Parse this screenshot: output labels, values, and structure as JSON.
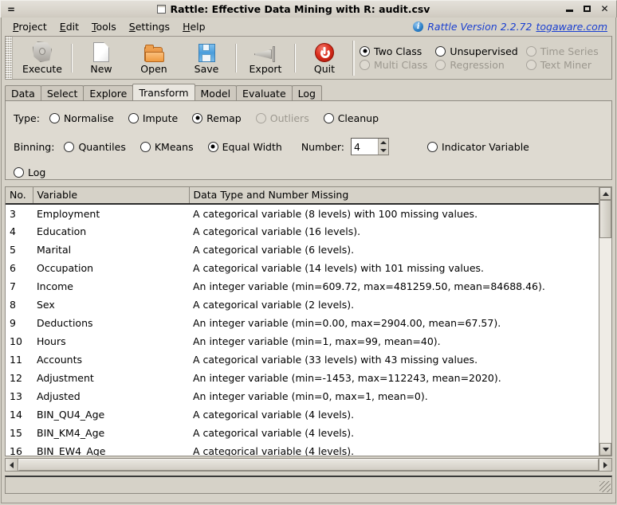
{
  "window": {
    "title": "Rattle: Effective Data Mining with R: audit.csv",
    "menu_glyph": "=",
    "buttons": {
      "minimize": "–",
      "maximize": "□",
      "close": "✕"
    }
  },
  "menubar": {
    "items": [
      {
        "label": "Project",
        "mnemonic": "P"
      },
      {
        "label": "Edit",
        "mnemonic": "E"
      },
      {
        "label": "Tools",
        "mnemonic": "T"
      },
      {
        "label": "Settings",
        "mnemonic": "S"
      },
      {
        "label": "Help",
        "mnemonic": "H"
      }
    ],
    "version_text": "Rattle Version 2.2.72",
    "website_link": "togaware.com",
    "link_color": "#1a3fd0"
  },
  "toolbar": {
    "buttons": [
      {
        "label": "Execute",
        "icon": "gear-icon"
      },
      {
        "label": "New",
        "icon": "new-document-icon"
      },
      {
        "label": "Open",
        "icon": "open-folder-icon"
      },
      {
        "label": "Save",
        "icon": "floppy-disk-icon"
      },
      {
        "label": "Export",
        "icon": "export-icon"
      },
      {
        "label": "Quit",
        "icon": "power-icon"
      }
    ],
    "modes": [
      {
        "label": "Two Class",
        "selected": true,
        "disabled": false
      },
      {
        "label": "Unsupervised",
        "selected": false,
        "disabled": false
      },
      {
        "label": "Time Series",
        "selected": false,
        "disabled": true
      },
      {
        "label": "Multi Class",
        "selected": false,
        "disabled": true
      },
      {
        "label": "Regression",
        "selected": false,
        "disabled": true
      },
      {
        "label": "Text Miner",
        "selected": false,
        "disabled": true
      }
    ]
  },
  "tabs": [
    {
      "label": "Data",
      "active": false
    },
    {
      "label": "Select",
      "active": false
    },
    {
      "label": "Explore",
      "active": false
    },
    {
      "label": "Transform",
      "active": true
    },
    {
      "label": "Model",
      "active": false
    },
    {
      "label": "Evaluate",
      "active": false
    },
    {
      "label": "Log",
      "active": false
    }
  ],
  "options": {
    "type_label": "Type:",
    "type_options": [
      {
        "label": "Normalise",
        "selected": false,
        "disabled": false
      },
      {
        "label": "Impute",
        "selected": false,
        "disabled": false
      },
      {
        "label": "Remap",
        "selected": true,
        "disabled": false
      },
      {
        "label": "Outliers",
        "selected": false,
        "disabled": true
      },
      {
        "label": "Cleanup",
        "selected": false,
        "disabled": false
      }
    ],
    "binning_label": "Binning:",
    "binning_options": [
      {
        "label": "Quantiles",
        "selected": false,
        "disabled": false
      },
      {
        "label": "KMeans",
        "selected": false,
        "disabled": false
      },
      {
        "label": "Equal Width",
        "selected": true,
        "disabled": false
      }
    ],
    "number_label": "Number:",
    "number_value": "4",
    "indicator_option": {
      "label": "Indicator Variable",
      "selected": false,
      "disabled": false
    },
    "log_option": {
      "label": "Log",
      "selected": false,
      "disabled": false
    }
  },
  "table": {
    "headers": [
      "No.",
      "Variable",
      "Data Type and Number Missing"
    ],
    "rows": [
      {
        "no": "3",
        "variable": "Employment",
        "desc": "A categorical variable (8 levels) with 100 missing values."
      },
      {
        "no": "4",
        "variable": "Education",
        "desc": "A categorical variable (16 levels)."
      },
      {
        "no": "5",
        "variable": "Marital",
        "desc": "A categorical variable (6 levels)."
      },
      {
        "no": "6",
        "variable": "Occupation",
        "desc": "A categorical variable (14 levels) with 101 missing values."
      },
      {
        "no": "7",
        "variable": "Income",
        "desc": "An integer variable (min=609.72, max=481259.50, mean=84688.46)."
      },
      {
        "no": "8",
        "variable": "Sex",
        "desc": "A categorical variable (2 levels)."
      },
      {
        "no": "9",
        "variable": "Deductions",
        "desc": "An integer variable (min=0.00, max=2904.00, mean=67.57)."
      },
      {
        "no": "10",
        "variable": "Hours",
        "desc": "An integer variable (min=1, max=99, mean=40)."
      },
      {
        "no": "11",
        "variable": "Accounts",
        "desc": "A categorical variable (33 levels) with 43 missing values."
      },
      {
        "no": "12",
        "variable": "Adjustment",
        "desc": "An integer variable (min=-1453, max=112243, mean=2020)."
      },
      {
        "no": "13",
        "variable": "Adjusted",
        "desc": "An integer variable (min=0, max=1, mean=0)."
      },
      {
        "no": "14",
        "variable": "BIN_QU4_Age",
        "desc": "A categorical variable (4 levels)."
      },
      {
        "no": "15",
        "variable": "BIN_KM4_Age",
        "desc": "A categorical variable (4 levels)."
      },
      {
        "no": "16",
        "variable": "BIN_EW4_Age",
        "desc": "A categorical variable (4 levels)."
      }
    ]
  },
  "statusbar": {
    "text": ""
  }
}
